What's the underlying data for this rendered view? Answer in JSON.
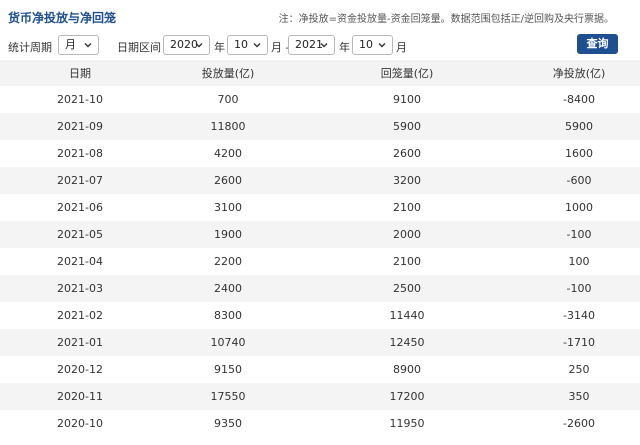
{
  "header": {
    "title": "货币净投放与净回笼",
    "note": "注：净投放=资金投放量-资金回笼量。数据范围包括正/逆回购及央行票据。"
  },
  "filter": {
    "period_label": "统计周期",
    "period_value": "月",
    "range_label": "日期区间",
    "start_year": "2020",
    "year_unit": "年",
    "start_month": "10",
    "month_unit_dash": "月 -",
    "end_year": "2021",
    "end_month": "10",
    "month_unit": "月",
    "query_label": "查询"
  },
  "table": {
    "columns": [
      "日期",
      "投放量(亿)",
      "回笼量(亿)",
      "净投放(亿)"
    ],
    "rows": [
      [
        "2021-10",
        "700",
        "9100",
        "-8400"
      ],
      [
        "2021-09",
        "11800",
        "5900",
        "5900"
      ],
      [
        "2021-08",
        "4200",
        "2600",
        "1600"
      ],
      [
        "2021-07",
        "2600",
        "3200",
        "-600"
      ],
      [
        "2021-06",
        "3100",
        "2100",
        "1000"
      ],
      [
        "2021-05",
        "1900",
        "2000",
        "-100"
      ],
      [
        "2021-04",
        "2200",
        "2100",
        "100"
      ],
      [
        "2021-03",
        "2400",
        "2500",
        "-100"
      ],
      [
        "2021-02",
        "8300",
        "11440",
        "-3140"
      ],
      [
        "2021-01",
        "10740",
        "12450",
        "-1710"
      ],
      [
        "2020-12",
        "9150",
        "8900",
        "250"
      ],
      [
        "2020-11",
        "17550",
        "17200",
        "350"
      ],
      [
        "2020-10",
        "9350",
        "11950",
        "-2600"
      ]
    ]
  }
}
